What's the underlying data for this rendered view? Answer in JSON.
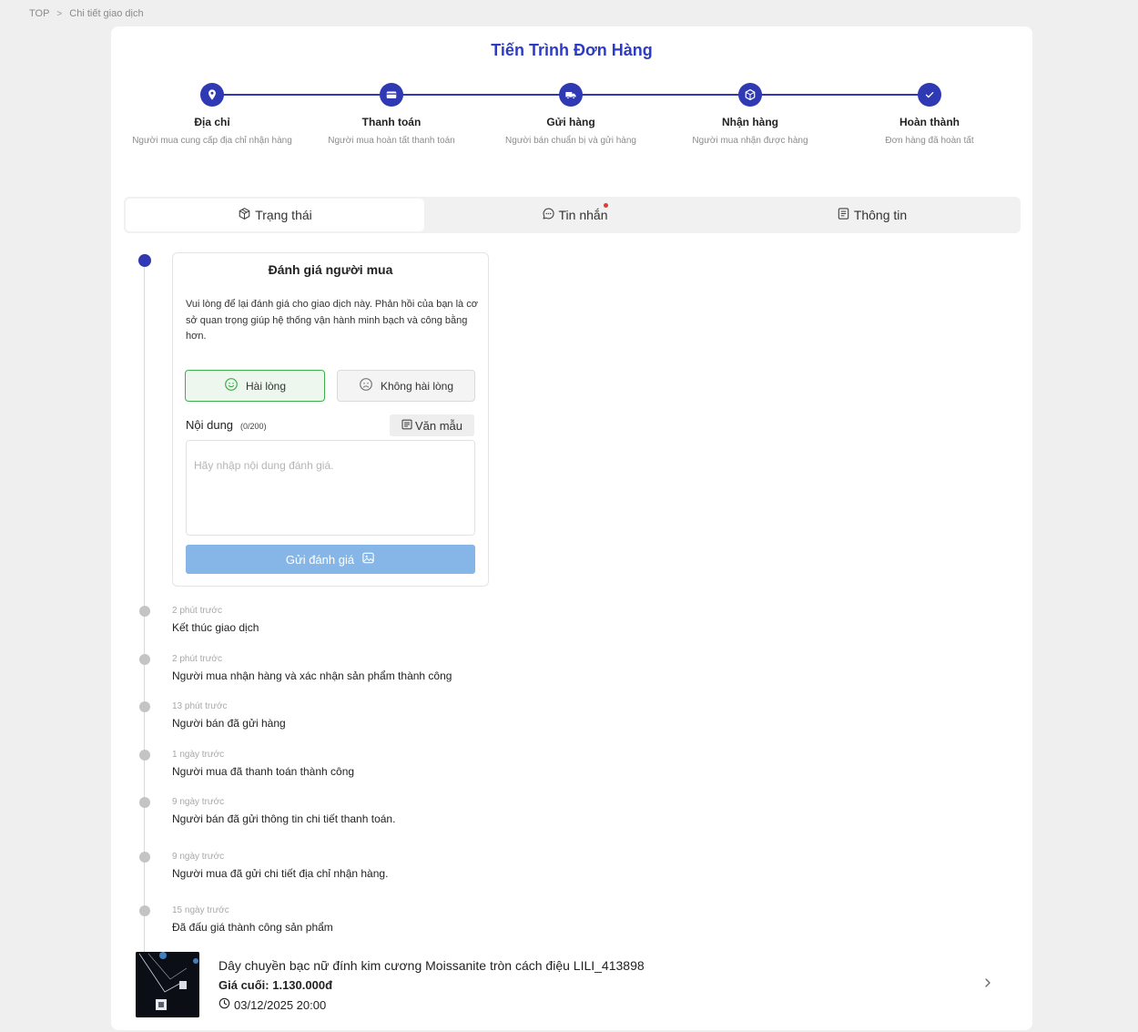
{
  "breadcrumb": {
    "home": "TOP",
    "current": "Chi tiết giao dịch"
  },
  "page": {
    "title": "Tiến Trình Đơn Hàng"
  },
  "steps": [
    {
      "title": "Địa chỉ",
      "desc": "Người mua cung cấp địa chỉ nhận hàng",
      "icon": "map-pin-icon"
    },
    {
      "title": "Thanh toán",
      "desc": "Người mua hoàn tất thanh toán",
      "icon": "card-icon"
    },
    {
      "title": "Gửi hàng",
      "desc": "Người bán chuẩn bị và gửi hàng",
      "icon": "truck-icon"
    },
    {
      "title": "Nhận hàng",
      "desc": "Người mua nhận được hàng",
      "icon": "box-icon"
    },
    {
      "title": "Hoàn thành",
      "desc": "Đơn hàng đã hoàn tất",
      "icon": "check-icon"
    }
  ],
  "tabs": [
    {
      "label": "Trạng thái",
      "icon": "package-icon",
      "active": true
    },
    {
      "label": "Tin nhắn",
      "icon": "chat-icon",
      "badge": true
    },
    {
      "label": "Thông tin",
      "icon": "document-icon"
    }
  ],
  "review": {
    "title": "Đánh giá người mua",
    "description": "Vui lòng để lại đánh giá cho giao dịch này. Phản hồi của bạn là cơ sở quan trọng giúp hệ thống vận hành minh bạch và công bằng hơn.",
    "option_good": "Hài lòng",
    "option_bad": "Không hài lòng",
    "content_label": "Nội dung",
    "content_count": "(0/200)",
    "template_button": "Văn mẫu",
    "input_value": "",
    "input_placeholder": "Hãy nhập nội dung đánh giá.",
    "submit_button": "Gửi đánh giá"
  },
  "timeline": [
    {
      "time": "2 phút trước",
      "text": "Kết thúc giao dịch"
    },
    {
      "time": "2 phút trước",
      "text": "Người mua nhận hàng và xác nhận sản phẩm thành công"
    },
    {
      "time": "13 phút trước",
      "text": "Người bán đã gửi hàng"
    },
    {
      "time": "1 ngày trước",
      "text": "Người mua đã thanh toán thành công"
    },
    {
      "time": "9 ngày trước",
      "text": "Người bán đã gửi thông tin chi tiết thanh toán."
    },
    {
      "time": "9 ngày trước",
      "text": "Người mua đã gửi chi tiết địa chỉ nhận hàng."
    },
    {
      "time": "15 ngày trước",
      "text": "Đã đấu giá thành công sản phẩm"
    }
  ],
  "product": {
    "name": "Dây chuyền bạc nữ đính kim cương Moissanite tròn cách điệu LILI_413898",
    "price": "Giá cuối: 1.130.000đ",
    "date": "03/12/2025 20:00"
  },
  "colors": {
    "primary": "#2f39b3",
    "title": "#2d3cc4",
    "success_border": "#3fae4a",
    "submit_disabled": "#86b6e8",
    "badge": "#e53935"
  }
}
